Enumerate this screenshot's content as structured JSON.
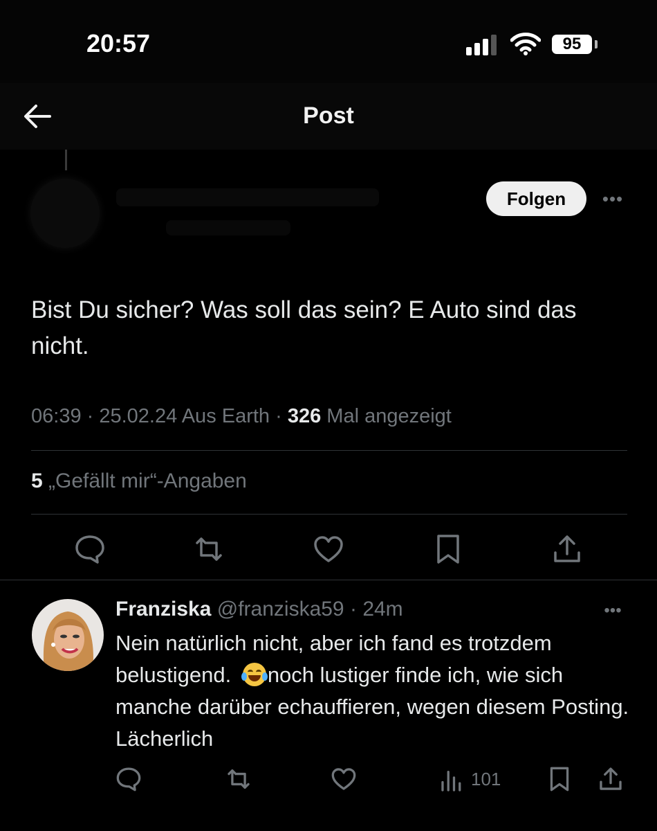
{
  "status_bar": {
    "time": "20:57",
    "battery_level": "95",
    "icons": [
      "cellular-signal-icon",
      "wifi-icon",
      "battery-icon"
    ]
  },
  "nav": {
    "title": "Post",
    "back_icon": "arrow-left-icon"
  },
  "post": {
    "follow_label": "Folgen",
    "more_icon": "ellipsis-icon",
    "text": "Bist Du sicher? Was soll das sein? E Auto sind das nicht.",
    "time": "06:39",
    "date": "25.02.24",
    "source": "Aus Earth",
    "views": "326",
    "views_label": "Mal angezeigt",
    "likes_count": "5",
    "likes_label": "„Gefällt mir“-Angaben",
    "actions": [
      "reply-icon",
      "retweet-icon",
      "like-icon",
      "bookmark-icon",
      "share-icon"
    ]
  },
  "reply": {
    "name": "Franziska",
    "handle": "@franziska59",
    "age": "24m",
    "text_part1": "Nein natürlich nicht, aber ich fand es trotzdem belustigend. ",
    "emoji": "face-with-tears-of-joy",
    "text_part2": "noch lustiger finde ich, wie sich manche darüber echauffieren, wegen diesem Posting. Lächerlich",
    "views": "101",
    "actions": [
      "reply-icon",
      "retweet-icon",
      "like-icon",
      "views-icon",
      "bookmark-icon",
      "share-icon"
    ]
  },
  "colors": {
    "background": "#000000",
    "text_primary": "#e7e9ea",
    "text_secondary": "#71767b",
    "divider": "#2f3336",
    "follow_button_bg": "#efefef"
  }
}
